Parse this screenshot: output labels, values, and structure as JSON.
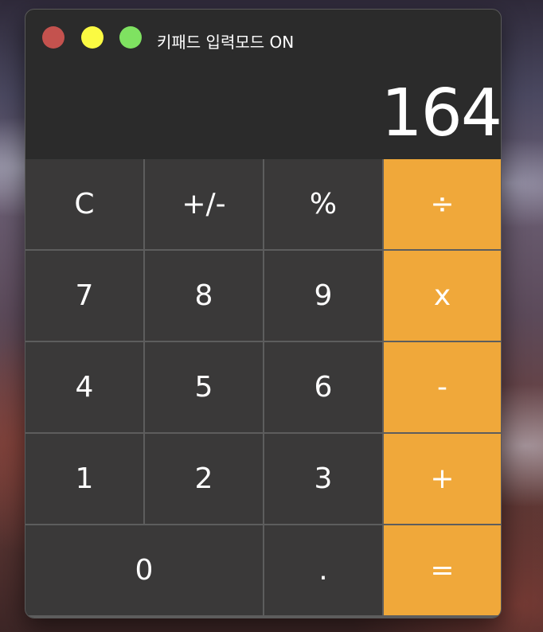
{
  "window": {
    "title": "키패드 입력모드 ON",
    "traffic_lights": [
      "close",
      "minimize",
      "zoom"
    ]
  },
  "display": {
    "value": "164"
  },
  "colors": {
    "operator": "#f0a83a",
    "key": "#3a3939",
    "window": "#2b2b2b",
    "close": "#c4524e",
    "minimize": "#fbfa42",
    "zoom": "#7fe261"
  },
  "keys": {
    "clear": "C",
    "sign": "+/-",
    "percent": "%",
    "divide": "÷",
    "seven": "7",
    "eight": "8",
    "nine": "9",
    "multiply": "x",
    "four": "4",
    "five": "5",
    "six": "6",
    "subtract": "-",
    "one": "1",
    "two": "2",
    "three": "3",
    "add": "+",
    "zero": "0",
    "decimal": ".",
    "equals": "="
  }
}
